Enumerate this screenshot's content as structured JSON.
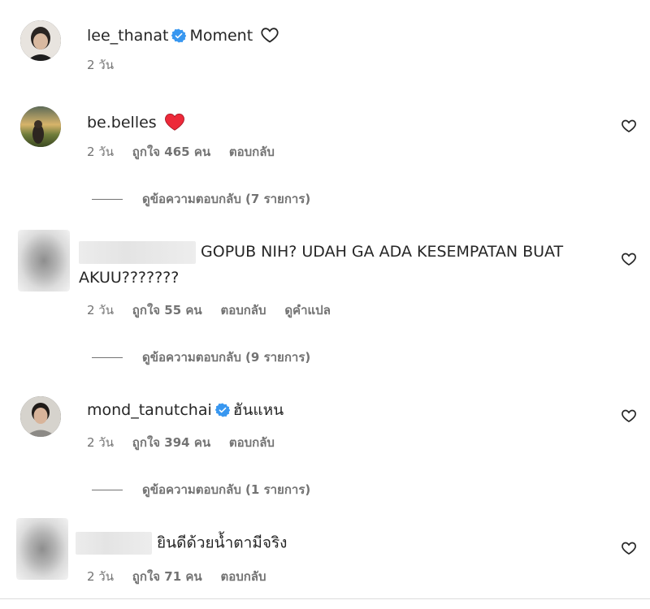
{
  "post_caption": {
    "username": "lee_thanat",
    "verified": true,
    "text": "Moment",
    "time": "2 วัน",
    "icon": "heart-outline-icon"
  },
  "comments": [
    {
      "username": "be.belles",
      "text": "",
      "emoji": "red-heart",
      "time": "2 วัน",
      "likes": "ถูกใจ 465 คน",
      "reply": "ตอบกลับ",
      "view_replies": "ดูข้อความตอบกลับ (7 รายการ)"
    },
    {
      "username": "",
      "text": "GOPUB NIH? UDAH GA ADA KESEMPATAN BUAT AKUU???????",
      "time": "2 วัน",
      "likes": "ถูกใจ 55 คน",
      "reply": "ตอบกลับ",
      "translate": "ดูคำแปล",
      "view_replies": "ดูข้อความตอบกลับ (9 รายการ)"
    },
    {
      "username": "mond_tanutchai",
      "verified": true,
      "text": "ฮันแหน",
      "time": "2 วัน",
      "likes": "ถูกใจ 394 คน",
      "reply": "ตอบกลับ",
      "view_replies": "ดูข้อความตอบกลับ (1 รายการ)"
    },
    {
      "username": "",
      "text": "ยินดีด้วยน้ำตามีจริง",
      "time": "2 วัน",
      "likes": "ถูกใจ 71 คน",
      "reply": "ตอบกลับ"
    }
  ],
  "colors": {
    "text": "#262626",
    "secondary": "#737373",
    "verified_blue": "#3897f0",
    "heart_red": "#ed2939"
  }
}
